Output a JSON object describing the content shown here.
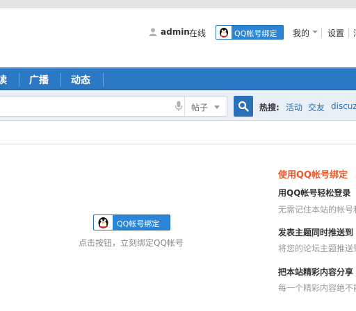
{
  "userbar": {
    "username": "admin",
    "status": "在线",
    "qq_bind_label": "QQ帐号绑定",
    "my_label": "我的",
    "settings_label": "设置",
    "clipped_label": "消"
  },
  "nav": {
    "items": [
      {
        "label": "读"
      },
      {
        "label": "广播"
      },
      {
        "label": "动态"
      }
    ]
  },
  "search": {
    "type_label": "帖子",
    "hot_label": "热搜:",
    "hot_links": [
      "活动",
      "交友",
      "discuz"
    ]
  },
  "main": {
    "bind_button_label": "QQ帐号绑定",
    "bind_hint": "点击按钮，立刻绑定QQ帐号"
  },
  "side": {
    "title": "使用QQ帐号绑定",
    "features": [
      {
        "title": "用QQ帐号轻松登录",
        "desc": "无需记住本站的帐号和密码"
      },
      {
        "title": "发表主题同时推送到",
        "desc": "将您的论坛主题推送到"
      },
      {
        "title": "把本站精彩内容分享",
        "desc": "每一个精彩内容绝不能"
      }
    ]
  },
  "colors": {
    "nav_bg": "#2b78c5",
    "accent_orange": "#e8592c",
    "link_blue": "#2b6fb6"
  }
}
